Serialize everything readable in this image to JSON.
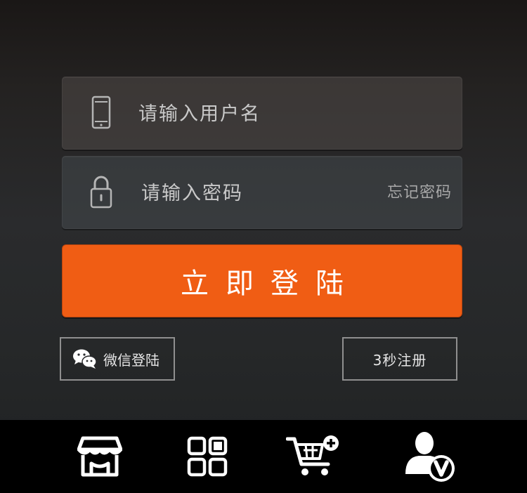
{
  "login_form": {
    "username_placeholder": "请输入用户名",
    "password_placeholder": "请输入密码",
    "forgot_password_label": "忘记密码",
    "login_button_label": "立即登陆",
    "wechat_login_label": "微信登陆",
    "register_label": "3秒注册"
  },
  "bottom_nav": {
    "items": [
      {
        "name": "store",
        "icon": "store-icon"
      },
      {
        "name": "categories",
        "icon": "grid-icon"
      },
      {
        "name": "cart",
        "icon": "cart-add-icon"
      },
      {
        "name": "account",
        "icon": "user-vip-icon"
      }
    ]
  },
  "colors": {
    "accent": "#f05d14",
    "nav_background": "#000000",
    "field_text": "#c9c9c9"
  }
}
